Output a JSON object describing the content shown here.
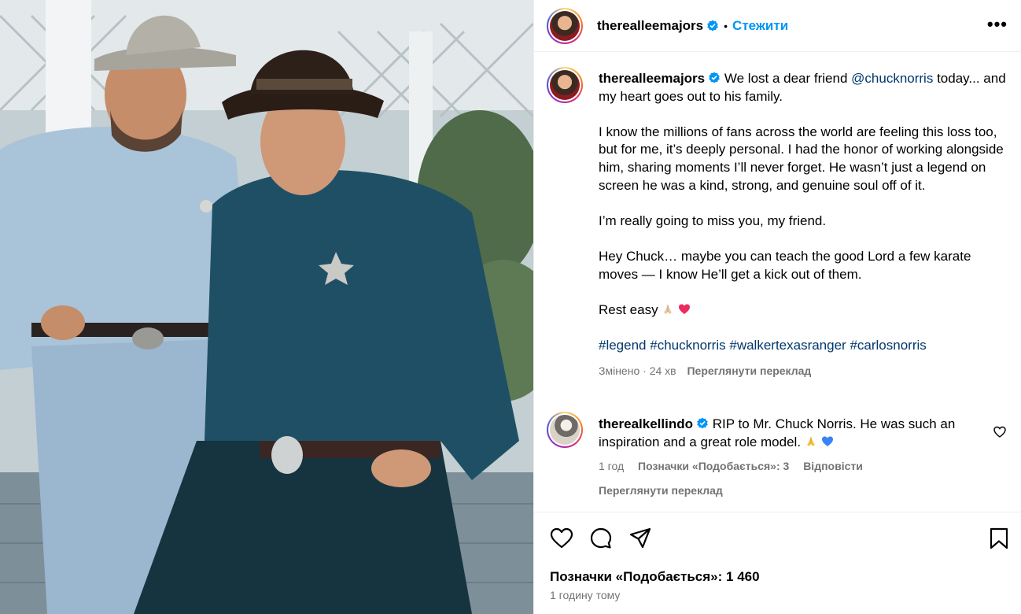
{
  "photo": {
    "description_icon": "photo-icon"
  },
  "header": {
    "username": "therealleemajors",
    "separator": "•",
    "follow_label": "Стежити",
    "more_label": "•••"
  },
  "post": {
    "username": "therealleemajors",
    "intro_text": "We lost a dear friend",
    "mention": "@chucknorris",
    "intro_tail": "today... and my heart goes out to his family.",
    "paragraph2": "I know the millions of fans across the world are feeling this loss too, but for me, it’s deeply personal. I had the honor of working alongside him, sharing moments I’ll never forget. He wasn’t just a legend on screen he was a kind, strong, and genuine soul off of it.",
    "paragraph3": "I’m really going to miss you, my friend.",
    "paragraph4": "Hey Chuck… maybe you can teach the good Lord a few karate moves — I know He’ll get a kick out of them.",
    "paragraph5": "Rest easy",
    "hashtags": [
      "#legend",
      "#chucknorris",
      "#walkertexasranger",
      "#carlosnorris"
    ],
    "edited_label": "Змінено",
    "meta_sep": "·",
    "edited_time": "24 хв",
    "translate_label": "Переглянути переклад"
  },
  "comment": {
    "username": "therealkellindo",
    "text": "RIP to Mr. Chuck Norris. He was such an inspiration and a great role model.",
    "time": "1 год",
    "likes_label": "Позначки «Подобається»: 3",
    "reply_label": "Відповісти",
    "translate_label": "Переглянути переклад"
  },
  "footer": {
    "likes_text": "Позначки «Подобається»: 1 460",
    "time_text": "1 годину тому"
  },
  "colors": {
    "accent": "#0095f6",
    "link": "#00376b",
    "muted": "#737373",
    "heart": "#ed2b5e",
    "blue_heart": "#3a82f7"
  }
}
